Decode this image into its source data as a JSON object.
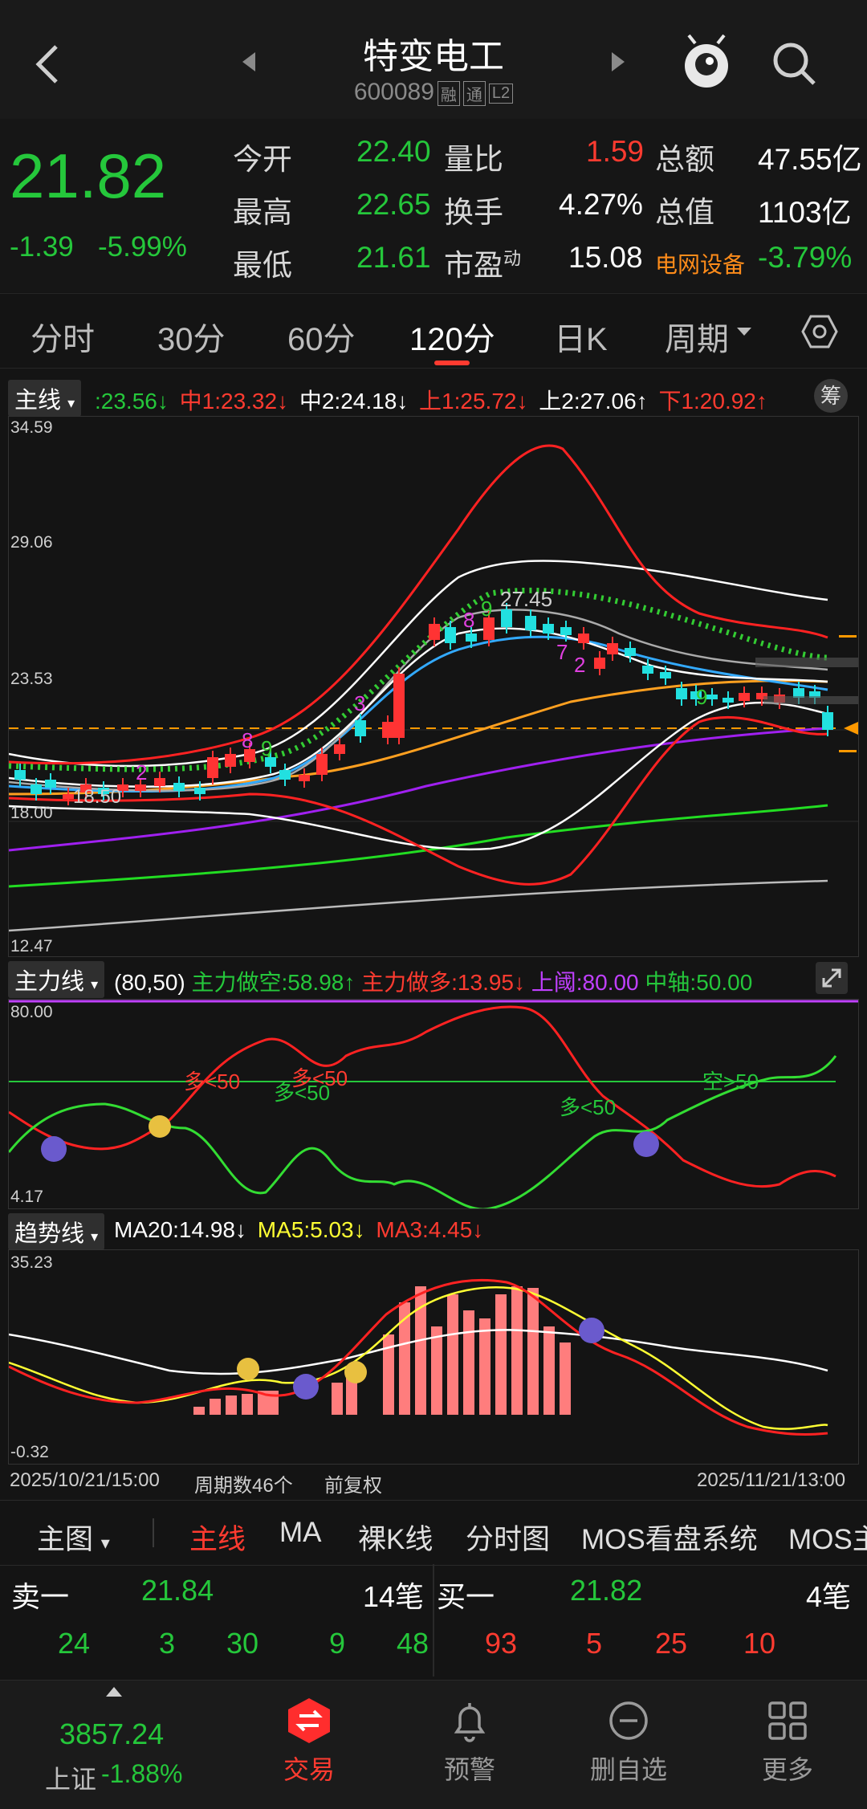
{
  "header": {
    "title": "特变电工",
    "code": "600089",
    "tags": [
      "融",
      "通",
      "L2"
    ]
  },
  "quote": {
    "price": "21.82",
    "change": "-1.39",
    "change_pct": "-5.99%",
    "rows": [
      {
        "l1": "今开",
        "v1": "22.40",
        "l2": "量比",
        "v2": "1.59",
        "l3": "总额",
        "v3": "47.55亿"
      },
      {
        "l1": "最高",
        "v1": "22.65",
        "l2": "换手",
        "v2": "4.27%",
        "l3": "总值",
        "v3": "1103亿"
      },
      {
        "l1": "最低",
        "v1": "21.61",
        "l2": "市盈",
        "l2sup": "动",
        "v2": "15.08",
        "l3": "电网设备",
        "v3": "-3.79%"
      }
    ]
  },
  "period_tabs": [
    "分时",
    "30分",
    "60分",
    "120分",
    "日K",
    "周期"
  ],
  "active_period": "120分",
  "main_chart": {
    "badge": "主线",
    "legend": [
      {
        "text": ":23.56↓",
        "color": "#25c73b"
      },
      {
        "text": "中1:23.32↓",
        "color": "#ff3b30"
      },
      {
        "text": "中2:24.18↓",
        "color": "#ffffff"
      },
      {
        "text": "上1:25.72↓",
        "color": "#ff3b30"
      },
      {
        "text": "上2:27.06↑",
        "color": "#ffffff"
      },
      {
        "text": "下1:20.92↑",
        "color": "#ff3b30"
      }
    ],
    "chip_label": "筹",
    "y_labels": [
      "34.59",
      "29.06",
      "23.53",
      "18.00",
      "12.47"
    ],
    "annotations": [
      "27.45",
      "18.50"
    ],
    "markers": [
      "2",
      "8",
      "9",
      "3",
      "8",
      "9",
      "7",
      "2",
      "9"
    ]
  },
  "mid_chart": {
    "badge": "主力线",
    "params": "(80,50)",
    "legend": [
      {
        "text": "主力做空:58.98↑",
        "color": "#25c73b"
      },
      {
        "text": "主力做多:13.95↓",
        "color": "#ff3b30"
      },
      {
        "text": "上阈:80.00",
        "color": "#c040ff"
      },
      {
        "text": "中轴:50.00",
        "color": "#25c73b"
      }
    ],
    "y_labels": [
      "80.00",
      "4.17"
    ],
    "annotations": [
      {
        "text": "多<50",
        "color": "#ff3b30"
      },
      {
        "text": "多<50",
        "color": "#25c73b"
      },
      {
        "text": "多<50",
        "color": "#ff3b30"
      },
      {
        "text": "多<50",
        "color": "#25c73b"
      },
      {
        "text": "空>50",
        "color": "#25c73b"
      }
    ]
  },
  "trend_chart": {
    "badge": "趋势线",
    "legend": [
      {
        "text": "MA20:14.98↓",
        "color": "#ffffff"
      },
      {
        "text": "MA5:5.03↓",
        "color": "#ffff33"
      },
      {
        "text": "MA3:4.45↓",
        "color": "#ff3b30"
      }
    ],
    "y_labels": [
      "35.23",
      "-0.32"
    ]
  },
  "timeline": {
    "start": "2025/10/21/15:00",
    "count": "周期数46个",
    "adjust": "前复权",
    "end": "2025/11/21/13:00"
  },
  "main_tabs": {
    "dropdown": "主图",
    "items": [
      "主线",
      "MA",
      "裸K线",
      "分时图",
      "MOS看盘系统",
      "MOS主"
    ],
    "active": "主线"
  },
  "order_book": {
    "sell_label": "卖一",
    "sell_price": "21.84",
    "sell_count": "14笔",
    "buy_label": "买一",
    "buy_price": "21.82",
    "buy_count": "4笔",
    "sell_detail": [
      "24",
      "3",
      "30",
      "9",
      "48"
    ],
    "buy_detail": [
      "93",
      "5",
      "25",
      "10"
    ]
  },
  "bottom_nav": {
    "index_value": "3857.24",
    "index_name": "上证",
    "index_change": "-1.88%",
    "items": [
      "交易",
      "预警",
      "删自选",
      "更多"
    ]
  }
}
